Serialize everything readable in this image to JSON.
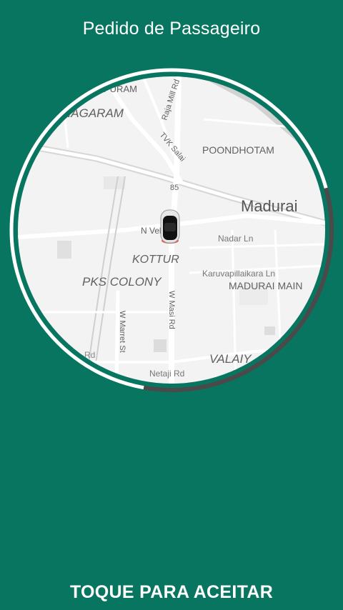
{
  "header": {
    "title": "Pedido de Passageiro"
  },
  "map": {
    "labels": {
      "puram": "PURAM",
      "nagaram": "NAGARAM",
      "raja_mill_rd": "Raja Mill Rd",
      "tvk_salai": "TVK Salai",
      "poondhotam": "POONDHOTAM",
      "road_85": "85",
      "madurai": "Madurai",
      "n_veli": "N Veli",
      "nadar_ln": "Nadar Ln",
      "kottur": "KOTTUR",
      "karuvapillaikara_ln": "Karuvapillaikara Ln",
      "pks_colony": "PKS COLONY",
      "madurai_main": "MADURAI MAIN",
      "w_masi_rd": "W Masi Rd",
      "w_marret_st": "W Marret St",
      "valaiy": "VALAIY",
      "netaji_rd": "Netaji Rd",
      "rd_fragment": "Rd"
    }
  },
  "timer": {
    "progress": 0.32,
    "track_color": "#ffffff",
    "progress_color": "#4a4a4a"
  },
  "footer": {
    "accept_label": "TOQUE PARA ACEITAR"
  },
  "colors": {
    "background": "#087560",
    "map_bg": "#f3f3f3",
    "road": "#ffffff",
    "text": "#616161"
  },
  "icons": {
    "car": "car-top-view-icon"
  }
}
